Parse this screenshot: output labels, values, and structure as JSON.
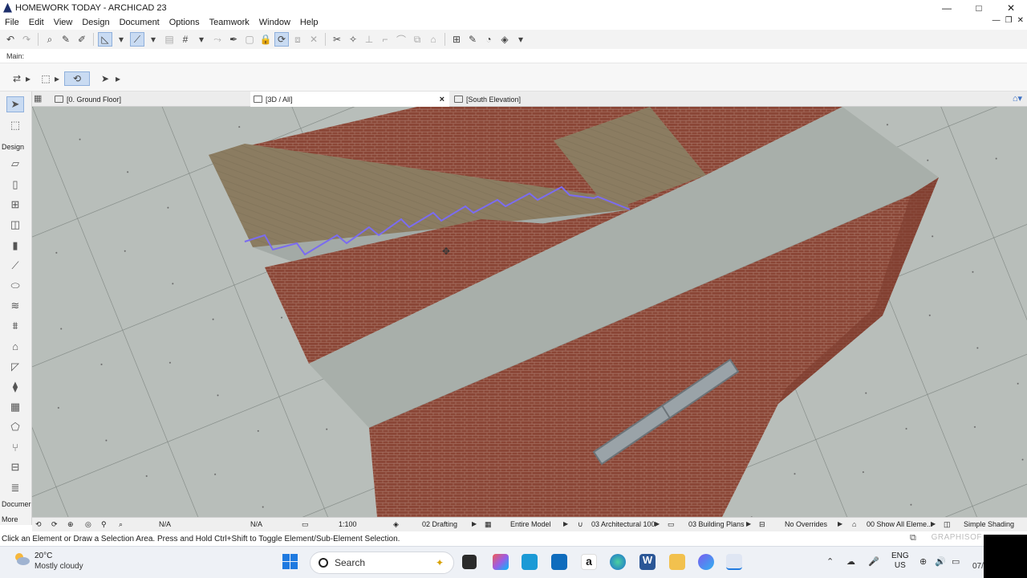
{
  "window": {
    "title": "HOMEWORK TODAY - ARCHICAD 23",
    "minimize": "—",
    "maximize": "□",
    "close": "✕"
  },
  "menu": [
    "File",
    "Edit",
    "View",
    "Design",
    "Document",
    "Options",
    "Teamwork",
    "Window",
    "Help"
  ],
  "info_box": {
    "label": "Main:"
  },
  "tabs": [
    {
      "label": "[0. Ground Floor]",
      "icon": "floor-plan-icon"
    },
    {
      "label": "[3D / All]",
      "icon": "3d-window-icon",
      "close": "×"
    },
    {
      "label": "[South Elevation]",
      "icon": "elevation-icon"
    }
  ],
  "toolbox": {
    "design_label": "Design",
    "document_label": "Documer",
    "more_label": "More"
  },
  "statusbar": {
    "zoom1": "N/A",
    "zoom2": "N/A",
    "scale": "1:100",
    "layer_combo": "02 Drafting",
    "model_view": "Entire Model",
    "pen_set": "03 Architectural 100",
    "mvo": "03 Building Plans",
    "graphic_override": "No Overrides",
    "renovation": "00 Show All Eleme...",
    "shading": "Simple Shading"
  },
  "message": "Click an Element or Draw a Selection Area. Press and Hold Ctrl+Shift to Toggle Element/Sub-Element Selection.",
  "watermark": "GRAPHISOF",
  "taskbar": {
    "weather_temp": "20°C",
    "weather_desc": "Mostly cloudy",
    "search_placeholder": "Search",
    "lang_line1": "ENG",
    "lang_line2": "US",
    "clock_partial": "07/"
  },
  "colors": {
    "accent": "#1f7ae0",
    "selection": "#7b6cf0",
    "brick": "#8c4637",
    "concrete": "#b9bfba",
    "wood": "#8a7c62"
  }
}
